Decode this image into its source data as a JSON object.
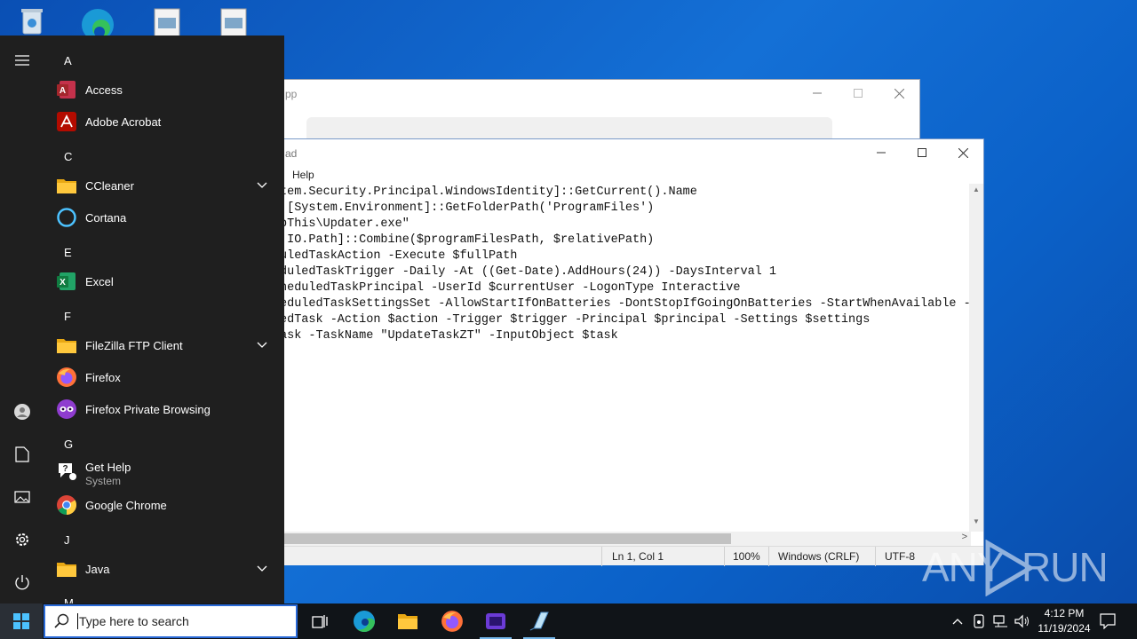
{
  "desktop": {
    "icons": [
      "recycle-bin-icon",
      "edge-icon",
      "file-icon",
      "file-icon"
    ]
  },
  "back_window": {
    "title_fragment": "pp"
  },
  "notepad": {
    "title_fragment": "ad",
    "menu_help": "Help",
    "lines": [
      "tem.Security.Principal.WindowsIdentity]::GetCurrent().Name",
      " [System.Environment]::GetFolderPath('ProgramFiles')",
      "pThis\\Updater.exe\"",
      ".IO.Path]::Combine($programFilesPath, $relativePath)",
      "uledTaskAction -Execute $fullPath",
      "duledTaskTrigger -Daily -At ((Get-Date).AddHours(24)) -DaysInterval 1",
      "heduledTaskPrincipal -UserId $currentUser -LogonType Interactive",
      "eduledTaskSettingsSet -AllowStartIfOnBatteries -DontStopIfGoingOnBatteries -StartWhenAvailable -",
      "edTask -Action $action -Trigger $trigger -Principal $principal -Settings $settings",
      "ask -TaskName \"UpdateTaskZT\" -InputObject $task"
    ],
    "status": {
      "position": "Ln 1, Col 1",
      "zoom": "100%",
      "line_ending": "Windows (CRLF)",
      "encoding": "UTF-8"
    }
  },
  "start_menu": {
    "letters": {
      "a": "A",
      "c": "C",
      "e": "E",
      "f": "F",
      "g": "G",
      "j": "J",
      "m": "M"
    },
    "apps": {
      "access": "Access",
      "adobe": "Adobe Acrobat",
      "ccleaner": "CCleaner",
      "cortana": "Cortana",
      "excel": "Excel",
      "filezilla": "FileZilla FTP Client",
      "firefox": "Firefox",
      "firefox_private": "Firefox Private Browsing",
      "gethelp": "Get Help",
      "gethelp_sub": "System",
      "chrome": "Google Chrome",
      "java": "Java"
    }
  },
  "taskbar": {
    "search_placeholder": "Type here to search",
    "time": "4:12 PM",
    "date": "11/19/2024"
  },
  "watermark": {
    "text_left": "ANY",
    "text_right": "RUN"
  }
}
